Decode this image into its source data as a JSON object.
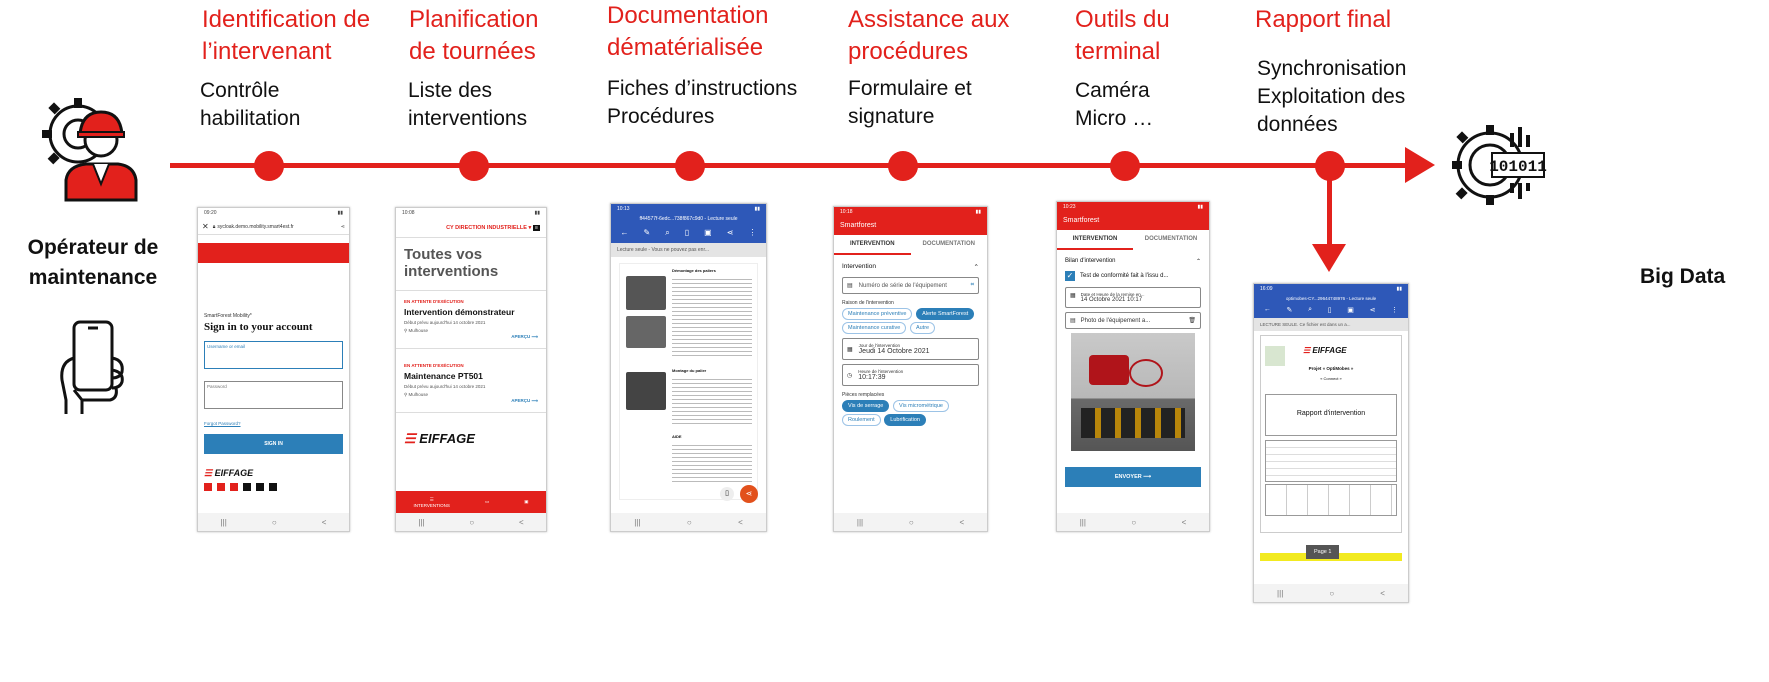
{
  "steps": [
    {
      "title": "Identification de\nl’intervenant",
      "desc": "Contrôle\nhabilitation"
    },
    {
      "title": "Planification\nde tournées",
      "desc": "Liste des\ninterventions"
    },
    {
      "title": "Documentation\ndématérialisée",
      "desc": "Fiches d’instructions\nProcédures"
    },
    {
      "title": "Assistance aux\nprocédures",
      "desc": "Formulaire et\nsignature"
    },
    {
      "title": "Outils du\nterminal",
      "desc": "Caméra\nMicro …"
    },
    {
      "title": "Rapport final",
      "desc": "Synchronisation\nExploitation des\ndonnées"
    }
  ],
  "left_label": "Opérateur de\nmaintenance",
  "right_label": "Big Data",
  "colors": {
    "accent": "#e2211c",
    "blue": "#2c7fb8"
  },
  "icons": {
    "operator": "maintenance-worker-gear-icon",
    "smartphone": "hand-holding-phone-icon",
    "bigdata": "big-data-gear-icon"
  },
  "screens": {
    "login": {
      "status_time": "09:20",
      "url": "sycloak.demo.mobility.smart4est.fr",
      "brand": "SmartForest Mobility*",
      "heading": "Sign in to your account",
      "username_placeholder": "Username or email",
      "password_placeholder": "Password",
      "forgot": "Forgot Password?",
      "signin": "SIGN IN",
      "logo": "EIFFAGE"
    },
    "list": {
      "status_time": "10:08",
      "header": "CY DIRECTION INDUSTRIELLE",
      "title": "Toutes vos interventions",
      "items": [
        {
          "status": "EN ATTENTE D'EXÉCUTION",
          "name": "Intervention démonstrateur",
          "date": "Début prévu aujourd'hui 14 octobre 2021",
          "place": "Mulhouse",
          "link": "APERÇU"
        },
        {
          "status": "EN ATTENTE D'EXÉCUTION",
          "name": "Maintenance PT501",
          "date": "Début prévu aujourd'hui 14 octobre 2021",
          "place": "Mulhouse",
          "link": "APERÇU"
        }
      ],
      "logo": "EIFFAGE",
      "nav_label": "INTERVENTIONS"
    },
    "doc": {
      "status_time": "10:13",
      "file": "ff44577f-6edc...738f867c9d0 - Lecture seule",
      "readonly": "Lecture seule - Vous ne pouvez pas enr...",
      "sec1": "Démontage des paliers",
      "sec2": "Montage du palier",
      "note": "AIDE"
    },
    "form": {
      "status_time": "10:18",
      "app": "Smartforest",
      "tab1": "INTERVENTION",
      "tab2": "DOCUMENTATION",
      "section": "Intervention",
      "serial": "Numéro de série de l'équipement",
      "reason_label": "Raison de l'intervention",
      "reasons": [
        "Maintenance préventive",
        "Alerte SmartForest",
        "Maintenance curative",
        "Autre"
      ],
      "day_label": "Jour de l'intervention",
      "day": "Jeudi 14 Octobre 2021",
      "hour_label": "Heure de l'intervention",
      "hour": "10:17:39",
      "parts_label": "Pièces remplacées",
      "parts": [
        "Vis de serrage",
        "Vis micrométrique",
        "Roulement",
        "Lubrification"
      ]
    },
    "camera": {
      "status_time": "10:23",
      "app": "Smartforest",
      "tab1": "INTERVENTION",
      "tab2": "DOCUMENTATION",
      "section": "Bilan d'intervention",
      "check": "Test de conformité fait à l'issu d...",
      "date_label": "Date et Heure de la remise en...",
      "date": "14 Octobre 2021 10:17",
      "photo": "Photo de l'équipement a...",
      "send": "ENVOYER"
    },
    "report": {
      "status_time": "16:09",
      "file": "optimobes-CY...29644748976 - Lecture seule",
      "readonly": "LECTURE SEULE. Ce fichier est dans un a...",
      "logo": "EIFFAGE",
      "project": "Projet « OptiMobes »",
      "sub": "« Connect »",
      "title": "Rapport d'intervention",
      "page": "Page 1"
    }
  }
}
